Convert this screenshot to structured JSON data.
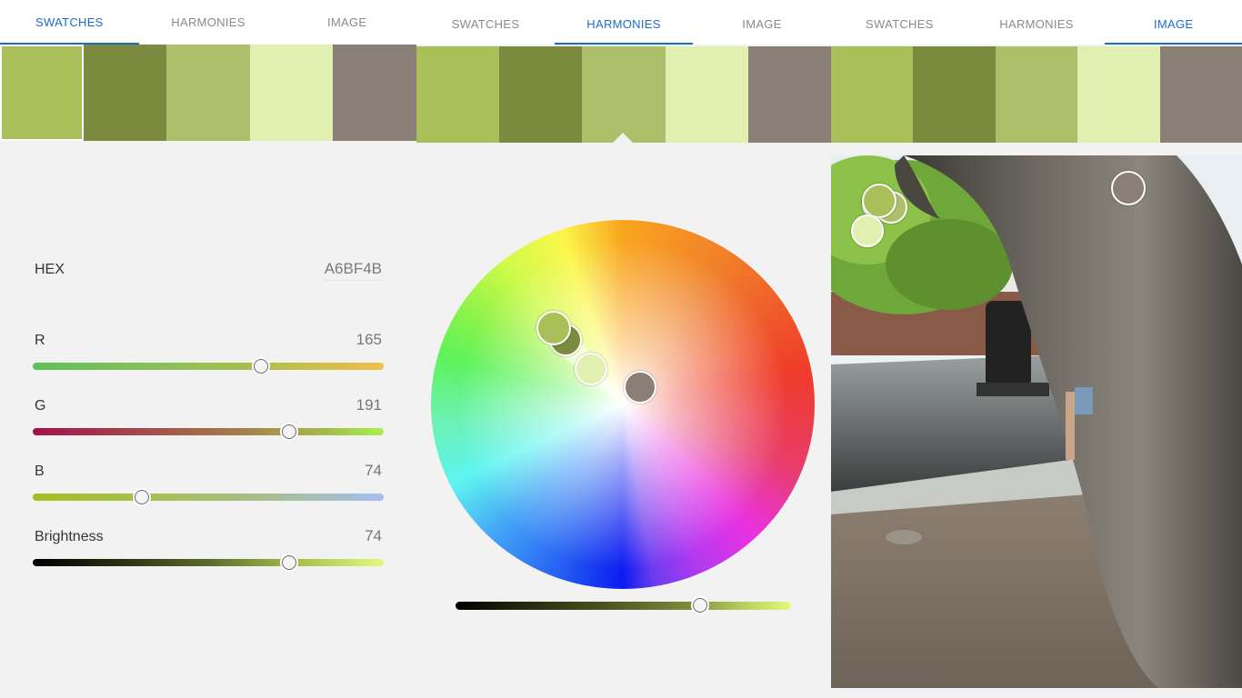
{
  "panels": [
    {
      "tabs": [
        {
          "label": "SWATCHES",
          "active": true
        },
        {
          "label": "HARMONIES",
          "active": false
        },
        {
          "label": "IMAGE",
          "active": false
        }
      ],
      "swatches": [
        "#a9bf59",
        "#7c8a40",
        "#adbf6a",
        "#e1f0b1",
        "#8a7f77"
      ]
    },
    {
      "tabs": [
        {
          "label": "SWATCHES",
          "active": false
        },
        {
          "label": "HARMONIES",
          "active": true
        },
        {
          "label": "IMAGE",
          "active": false
        }
      ],
      "swatches": [
        "#a9bf59",
        "#7c8a40",
        "#adbf6a",
        "#e1f0b1",
        "#8a7f77"
      ]
    },
    {
      "tabs": [
        {
          "label": "SWATCHES",
          "active": false
        },
        {
          "label": "HARMONIES",
          "active": false
        },
        {
          "label": "IMAGE",
          "active": true
        }
      ],
      "swatches": [
        "#a9bf59",
        "#7c8a40",
        "#adbf6a",
        "#e1f0b1",
        "#8a7f77"
      ]
    }
  ],
  "color_editor": {
    "hex_label": "HEX",
    "hex_value": "A6BF4B",
    "sliders": [
      {
        "label": "R",
        "value": "165",
        "level": 0.65
      },
      {
        "label": "G",
        "value": "191",
        "level": 0.73
      },
      {
        "label": "B",
        "value": "74",
        "level": 0.31
      },
      {
        "label": "Brightness",
        "value": "74",
        "level": 0.73
      }
    ]
  },
  "harmony": {
    "brightness_level": 0.73
  },
  "colors": {
    "accent": "#1a6ec8",
    "selected": "#a6bf4b"
  }
}
